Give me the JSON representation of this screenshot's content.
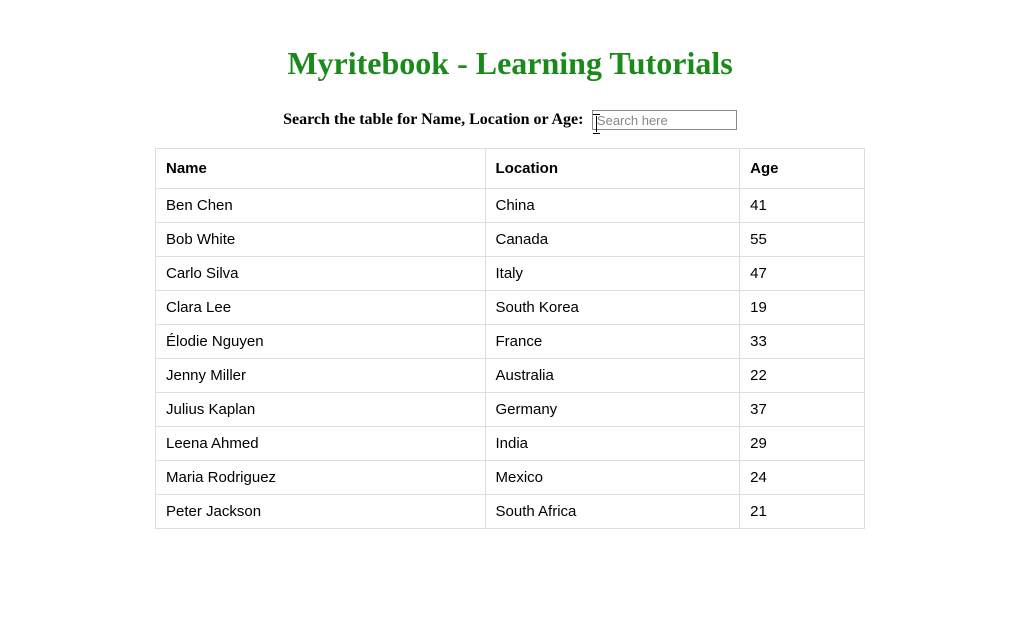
{
  "title": "Myritebook - Learning Tutorials",
  "search": {
    "label": "Search the table for Name, Location or Age:",
    "placeholder": "Search here",
    "value": ""
  },
  "table": {
    "headers": {
      "name": "Name",
      "location": "Location",
      "age": "Age"
    },
    "rows": [
      {
        "name": "Ben Chen",
        "location": "China",
        "age": "41"
      },
      {
        "name": "Bob White",
        "location": "Canada",
        "age": "55"
      },
      {
        "name": "Carlo Silva",
        "location": "Italy",
        "age": "47"
      },
      {
        "name": "Clara Lee",
        "location": "South Korea",
        "age": "19"
      },
      {
        "name": "Élodie Nguyen",
        "location": "France",
        "age": "33"
      },
      {
        "name": "Jenny Miller",
        "location": "Australia",
        "age": "22"
      },
      {
        "name": "Julius Kaplan",
        "location": "Germany",
        "age": "37"
      },
      {
        "name": "Leena Ahmed",
        "location": "India",
        "age": "29"
      },
      {
        "name": "Maria Rodriguez",
        "location": "Mexico",
        "age": "24"
      },
      {
        "name": "Peter Jackson",
        "location": "South Africa",
        "age": "21"
      }
    ]
  }
}
